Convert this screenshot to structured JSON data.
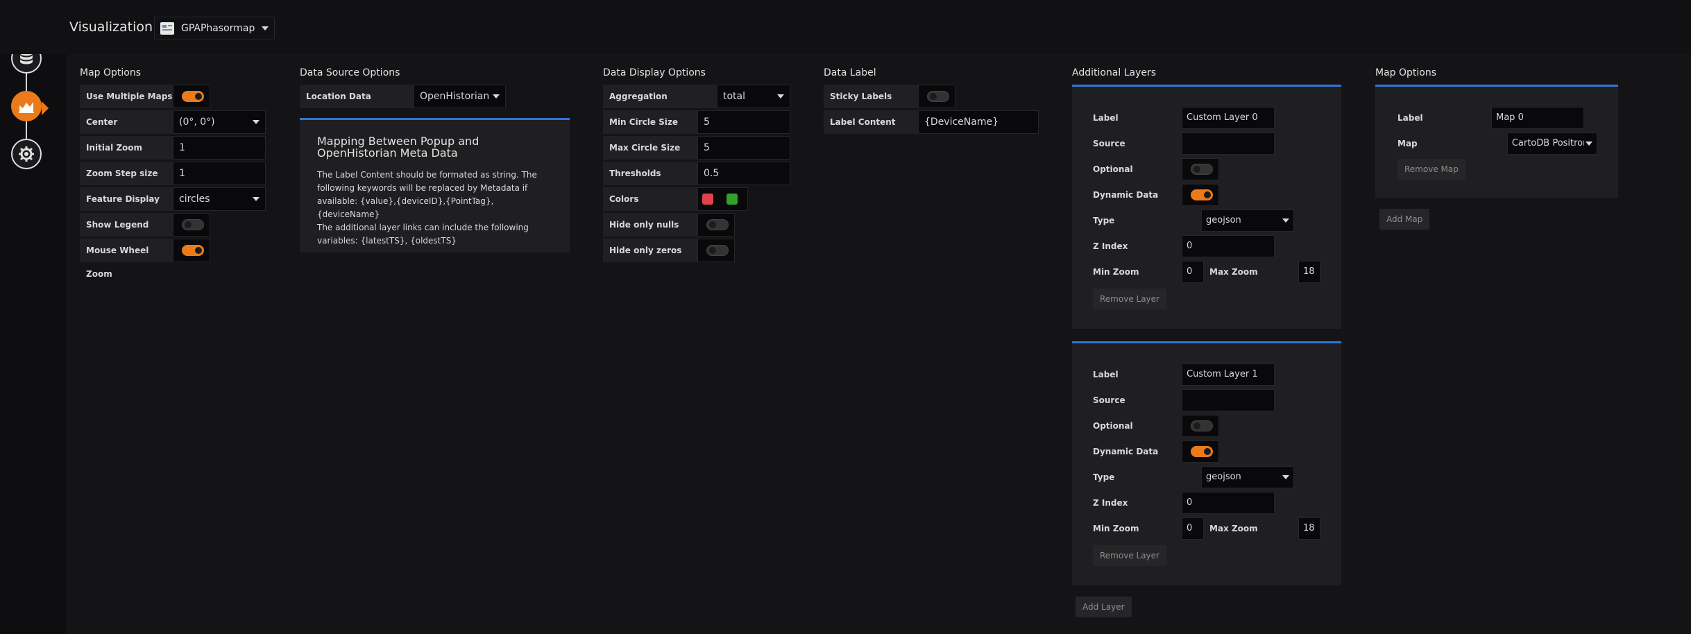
{
  "header": {
    "title": "Visualization",
    "panel_type": "GPAPhasormap"
  },
  "sidebar": {
    "icons": [
      "database-icon",
      "visualization-icon",
      "settings-icon"
    ],
    "active": "visualization-icon",
    "accent_color": "#eb7b18"
  },
  "map_options": {
    "title": "Map Options",
    "use_multiple_maps": {
      "label": "Use Multiple Maps",
      "on": true
    },
    "center": {
      "label": "Center",
      "value": "(0°, 0°)"
    },
    "initial_zoom": {
      "label": "Initial Zoom",
      "value": "1"
    },
    "zoom_step": {
      "label": "Zoom Step size",
      "value": "1"
    },
    "feature_display": {
      "label": "Feature Display",
      "value": "circles"
    },
    "show_legend": {
      "label": "Show Legend",
      "on": false
    },
    "mouse_wheel_zoom": {
      "label": "Mouse Wheel Zoom",
      "on": true
    }
  },
  "data_source": {
    "title": "Data Source Options",
    "location_data": {
      "label": "Location Data",
      "value": "OpenHistorian"
    },
    "info": {
      "title": "Mapping Between Popup and OpenHistorian Meta Data",
      "line1": "The Label Content should be formated as string. The",
      "line2": "following keywords will be replaced by Metadata if",
      "line3": "available: {value},{deviceID},{PointTag},{deviceName}",
      "line4": "The additional layer links can include the following",
      "line5": "variables: {latestTS}, {oldestTS}"
    }
  },
  "data_display": {
    "title": "Data Display Options",
    "aggregation": {
      "label": "Aggregation",
      "value": "total"
    },
    "min_circle": {
      "label": "Min Circle Size",
      "value": "5"
    },
    "max_circle": {
      "label": "Max Circle Size",
      "value": "5"
    },
    "thresholds": {
      "label": "Thresholds",
      "value": "0.5"
    },
    "colors": {
      "label": "Colors",
      "values": [
        "#e0424b",
        "#33a02c"
      ]
    },
    "hide_nulls": {
      "label": "Hide only nulls",
      "on": false
    },
    "hide_zeros": {
      "label": "Hide only zeros",
      "on": false
    }
  },
  "data_label": {
    "title": "Data Label",
    "sticky": {
      "label": "Sticky Labels",
      "on": false
    },
    "content": {
      "label": "Label Content",
      "value": "{DeviceName}"
    }
  },
  "additional_layers": {
    "title": "Additional Layers",
    "labels": {
      "label": "Label",
      "source": "Source",
      "optional": "Optional",
      "dynamic": "Dynamic Data",
      "type": "Type",
      "z_index": "Z Index",
      "min_zoom": "Min Zoom",
      "max_zoom": "Max Zoom",
      "remove": "Remove Layer"
    },
    "layers": [
      {
        "label": "Custom Layer 0",
        "source": "",
        "optional": false,
        "dynamic": true,
        "type": "geojson",
        "z_index": "0",
        "min_zoom": "0",
        "max_zoom": "18"
      },
      {
        "label": "Custom Layer 1",
        "source": "",
        "optional": false,
        "dynamic": true,
        "type": "geojson",
        "z_index": "0",
        "min_zoom": "0",
        "max_zoom": "18"
      }
    ],
    "add_label": "Add Layer"
  },
  "map_options2": {
    "title": "Map Options",
    "label_label": "Label",
    "label_value": "Map 0",
    "map_label": "Map",
    "map_value": "CartoDB Positron",
    "remove": "Remove Map",
    "add": "Add Map"
  },
  "colors": {
    "accent_blue": "#3274d9",
    "toggle_on": "#eb7b18"
  }
}
